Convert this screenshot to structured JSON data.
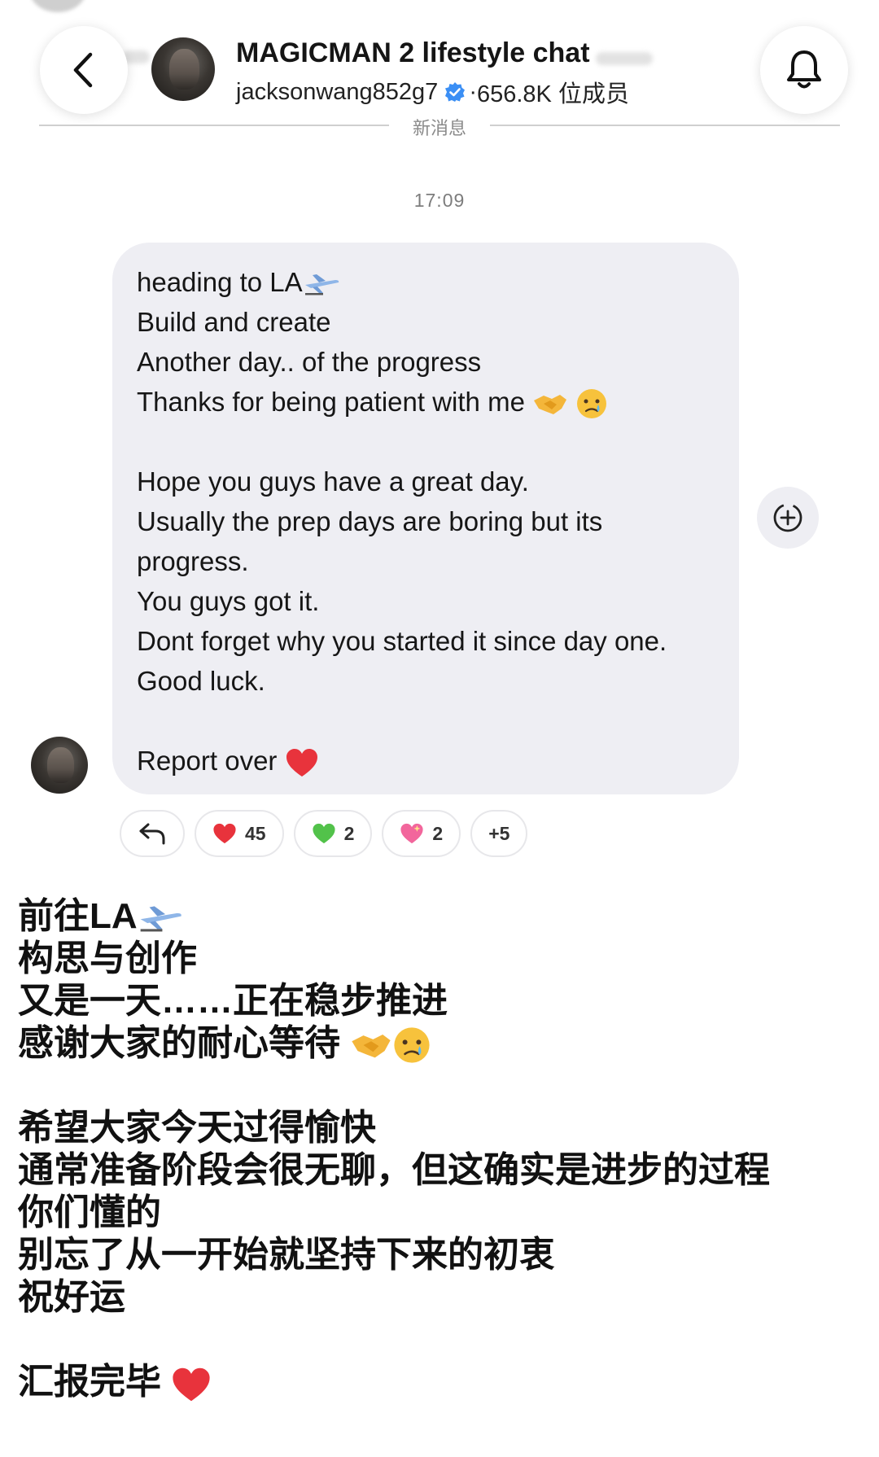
{
  "header": {
    "title": "MAGICMAN 2 lifestyle chat",
    "username": "jacksonwang852g7",
    "member_count": "656.8K 位成员",
    "separator": "·",
    "new_messages_divider": "新消息",
    "back_icon": "chevron-left-icon",
    "bell_icon": "bell-icon"
  },
  "chat": {
    "timestamp": "17:09",
    "message_lines": [
      "heading to LA",
      "Build and create",
      "Another day.. of the progress",
      "Thanks for being patient with me",
      "",
      "Hope you guys have a great day.",
      "Usually the prep days are boring but its",
      "progress.",
      "You guys got it.",
      "Dont forget why you started it since day one.",
      "Good luck.",
      "",
      "Report over"
    ],
    "reactions": [
      {
        "emoji": "❤️",
        "count": "45",
        "color": "#e8333c"
      },
      {
        "emoji": "💚",
        "count": "2",
        "color": "#52c24a"
      },
      {
        "emoji": "💖",
        "count": "2",
        "color": "#f2669c"
      }
    ],
    "more_reactions": "+5"
  },
  "translation": {
    "lines": [
      "前往LA",
      "构思与创作",
      "又是一天……正在稳步推进",
      "感谢大家的耐心等待",
      "",
      "希望大家今天过得愉快",
      "通常准备阶段会很无聊，但这确实是进步的过程",
      "你们懂的",
      "别忘了从一开始就坚持下来的初衷",
      "祝好运",
      "",
      "汇报完毕"
    ]
  },
  "colors": {
    "bubble_bg": "#eeeef3",
    "verified_blue": "#3b8ff5",
    "heart_red": "#e8333c"
  }
}
